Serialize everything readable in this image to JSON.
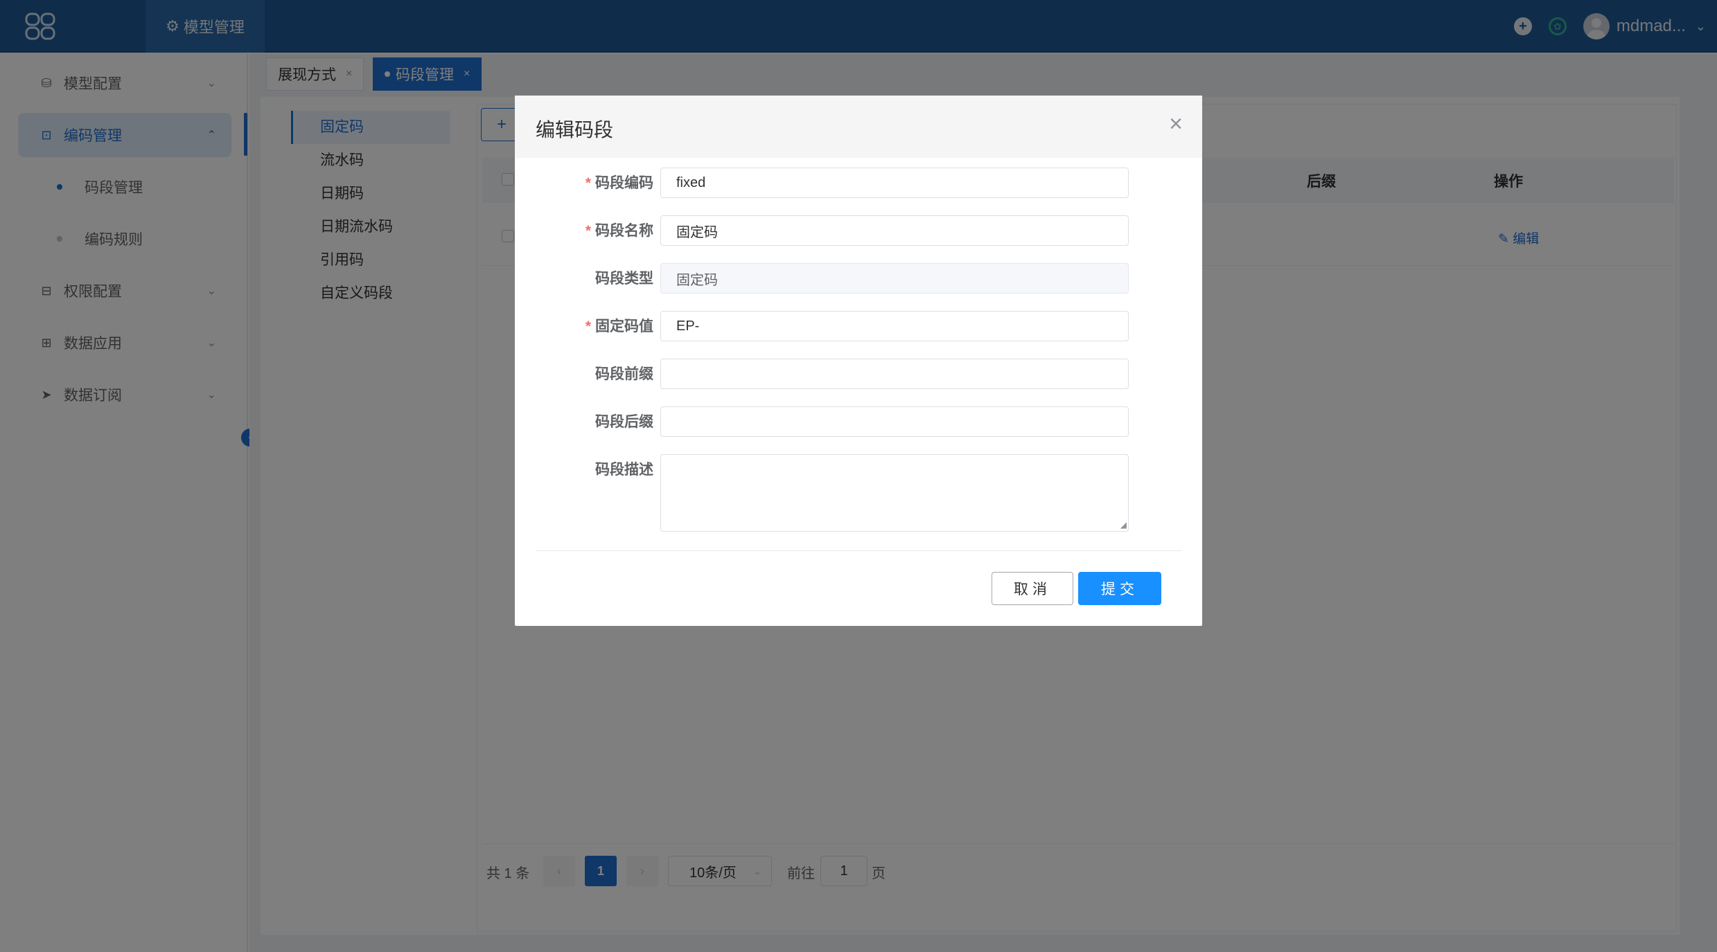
{
  "header": {
    "menu_label": "模型管理",
    "username": "mdmad..."
  },
  "sidebar": {
    "items": [
      {
        "label": "模型配置",
        "icon": "database-icon"
      },
      {
        "label": "编码管理",
        "icon": "code-icon"
      },
      {
        "label": "码段管理"
      },
      {
        "label": "编码规则"
      },
      {
        "label": "权限配置",
        "icon": "permission-icon"
      },
      {
        "label": "数据应用",
        "icon": "grid-icon"
      },
      {
        "label": "数据订阅",
        "icon": "send-icon"
      }
    ]
  },
  "tabs": [
    {
      "label": "展现方式"
    },
    {
      "label": "码段管理"
    }
  ],
  "segment_types": [
    "固定码",
    "流水码",
    "日期码",
    "日期流水码",
    "引用码",
    "自定义码段"
  ],
  "table": {
    "headers": {
      "suffix": "后缀",
      "action": "操作"
    },
    "edit_label": "编辑"
  },
  "pagination": {
    "total": "共 1 条",
    "current": "1",
    "page_size": "10条/页",
    "goto_label": "前往",
    "goto_value": "1",
    "page_label": "页"
  },
  "dialog": {
    "title": "编辑码段",
    "fields": [
      {
        "label": "码段编码",
        "required": "*",
        "value": "fixed"
      },
      {
        "label": "码段名称",
        "required": "*",
        "value": "固定码"
      },
      {
        "label": "码段类型",
        "value": "固定码"
      },
      {
        "label": "固定码值",
        "required": "*",
        "value": "EP-"
      },
      {
        "label": "码段前缀",
        "value": ""
      },
      {
        "label": "码段后缀",
        "value": ""
      },
      {
        "label": "码段描述",
        "value": ""
      }
    ],
    "cancel_label": "取消",
    "submit_label": "提交"
  },
  "colors": {
    "header": "#1f5a96",
    "accent": "#1f6fd0",
    "submit": "#1890ff",
    "required": "#f56c6c"
  }
}
